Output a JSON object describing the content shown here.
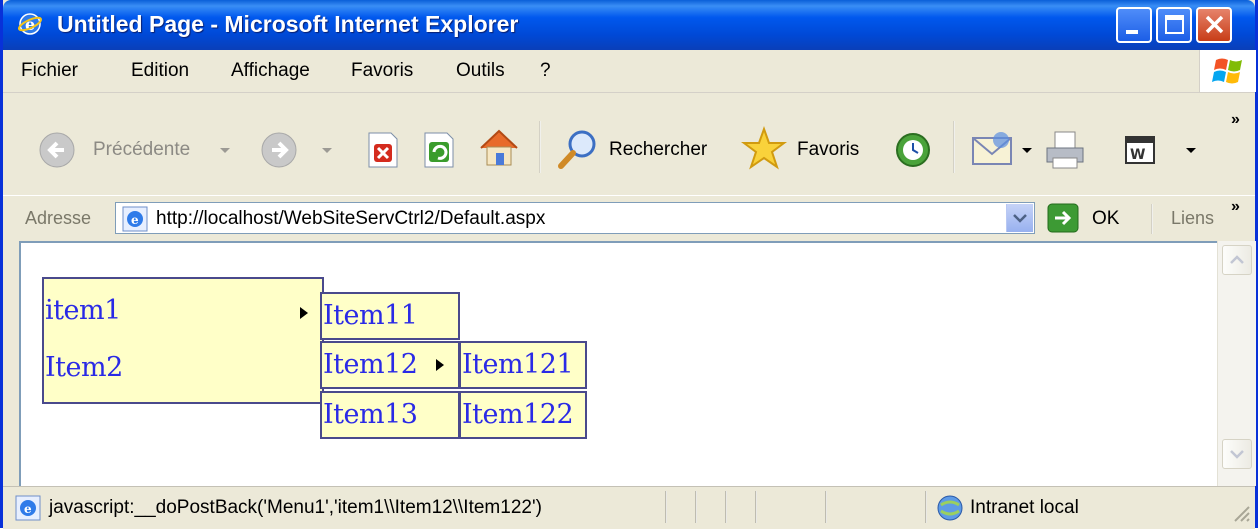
{
  "window": {
    "title": "Untitled Page - Microsoft Internet Explorer"
  },
  "menubar": {
    "items": [
      {
        "label": "Fichier"
      },
      {
        "label": "Edition"
      },
      {
        "label": "Affichage"
      },
      {
        "label": "Favoris"
      },
      {
        "label": "Outils"
      },
      {
        "label": "?"
      }
    ]
  },
  "toolbar": {
    "back_label": "Précédente",
    "search_label": "Rechercher",
    "favorites_label": "Favoris"
  },
  "address": {
    "label": "Adresse",
    "url": "http://localhost/WebSiteServCtrl2/Default.aspx",
    "go_label": "OK",
    "links_label": "Liens"
  },
  "menu": {
    "root": [
      "item1",
      "Item2"
    ],
    "level2": [
      "Item11",
      "Item12",
      "Item13"
    ],
    "level3": [
      "Item121",
      "Item122"
    ]
  },
  "statusbar": {
    "text": "javascript:__doPostBack('Menu1','item1\\\\Item12\\\\Item122')",
    "zone": "Intranet local"
  },
  "colors": {
    "titlebar": "#0058ee",
    "menu_bg": "#ffffc8",
    "menu_text": "#2a2ae6",
    "menu_border": "#4a4a8c"
  }
}
